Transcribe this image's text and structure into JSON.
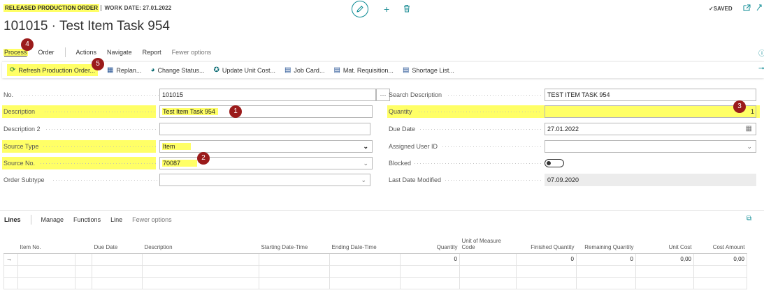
{
  "header": {
    "page_type": "RELEASED PRODUCTION ORDER",
    "work_date": "WORK DATE: 27.01.2022",
    "title": "101015 · Test Item Task 954",
    "saved": "✓SAVED"
  },
  "actions": {
    "process": "Process",
    "order": "Order",
    "actions": "Actions",
    "navigate": "Navigate",
    "report": "Report",
    "fewer": "Fewer options"
  },
  "toolbar": {
    "refresh": "Refresh Production Order...",
    "replan": "Replan...",
    "change_status": "Change Status...",
    "update_unit_cost": "Update Unit Cost...",
    "job_card": "Job Card...",
    "mat_requisition": "Mat. Requisition...",
    "shortage_list": "Shortage List..."
  },
  "form_left": {
    "no_label": "No.",
    "no_value": "101015",
    "no_btn": "···",
    "description_label": "Description",
    "description_value": "Test Item Task 954",
    "description2_label": "Description 2",
    "description2_value": "",
    "source_type_label": "Source Type",
    "source_type_value": "Item",
    "source_no_label": "Source No.",
    "source_no_value": "70087",
    "order_subtype_label": "Order Subtype",
    "order_subtype_value": ""
  },
  "form_right": {
    "search_desc_label": "Search Description",
    "search_desc_value": "TEST ITEM TASK 954",
    "quantity_label": "Quantity",
    "quantity_value": "1",
    "due_date_label": "Due Date",
    "due_date_value": "27.01.2022",
    "assigned_user_label": "Assigned User ID",
    "assigned_user_value": "",
    "blocked_label": "Blocked",
    "blocked_state": false,
    "last_modified_label": "Last Date Modified",
    "last_modified_value": "07.09.2020"
  },
  "markers": {
    "m1": "1",
    "m2": "2",
    "m3": "3",
    "m4": "4",
    "m5": "5"
  },
  "lines": {
    "title": "Lines",
    "manage": "Manage",
    "functions": "Functions",
    "line": "Line",
    "fewer": "Fewer options",
    "columns": [
      "Item No.",
      "Due Date",
      "Description",
      "Starting Date-Time",
      "Ending Date-Time",
      "Quantity",
      "Unit of Measure Code",
      "Finished Quantity",
      "Remaining Quantity",
      "Unit Cost",
      "Cost Amount"
    ],
    "row1": {
      "arrow": "→",
      "quantity": "0",
      "finished": "0",
      "remaining": "0",
      "unit_cost": "0,00",
      "cost_amount": "0,00"
    }
  },
  "colors": {
    "highlight": "#ffff66",
    "accent": "#0a8a93",
    "marker": "#9b1b1b",
    "selected_cell": "#b3e1e8"
  }
}
